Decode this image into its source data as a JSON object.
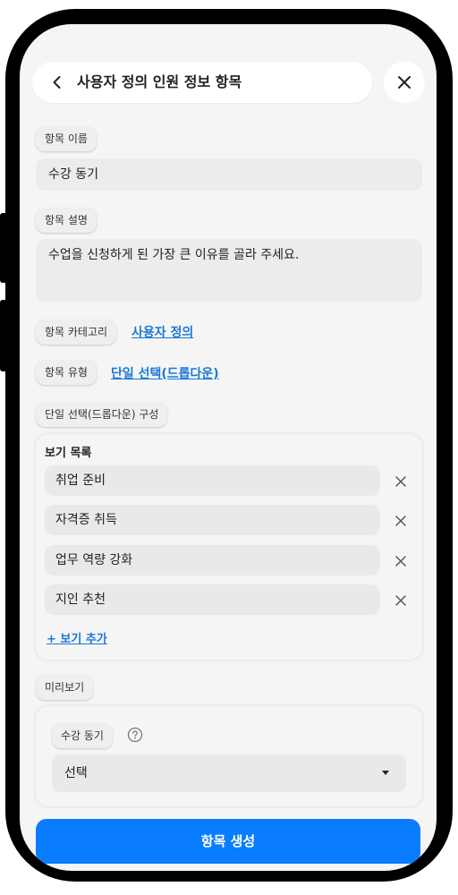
{
  "header": {
    "title": "사용자 정의 인원 정보 항목"
  },
  "fields": {
    "name_label": "항목 이름",
    "name_value": "수강 동기",
    "desc_label": "항목 설명",
    "desc_value": "수업을 신청하게 된 가장 큰 이유를 골라 주세요.",
    "category_label": "항목 카테고리",
    "category_value": "사용자 정의",
    "type_label": "항목 유형",
    "type_value": "단일 선택(드롭다운)"
  },
  "config": {
    "section_label": "단일 선택(드롭다운) 구성",
    "list_title": "보기 목록",
    "options": [
      {
        "label": "취업 준비"
      },
      {
        "label": "자격증 취득"
      },
      {
        "label": "업무 역량 강화"
      },
      {
        "label": "지인 추천"
      }
    ],
    "add_option": "+ 보기 추가"
  },
  "preview": {
    "section_label": "미리보기",
    "field_label": "수강 동기",
    "select_value": "선택"
  },
  "submit_label": "항목 생성",
  "icons": {
    "back": "chevron-left-icon",
    "close": "close-icon",
    "help": "question-circle-icon",
    "dropdown": "caret-down-icon"
  },
  "colors": {
    "primary": "#0a7cff",
    "link": "#1a78d6",
    "background": "#f5f5f5"
  }
}
